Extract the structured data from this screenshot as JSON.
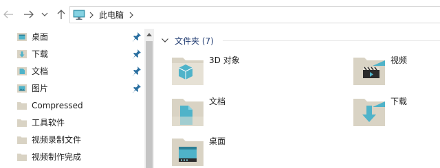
{
  "navigation": {
    "back_icon": "arrow-left-icon",
    "forward_icon": "arrow-right-icon",
    "recent_icon": "chevron-down-icon",
    "up_icon": "arrow-up-icon"
  },
  "address_bar": {
    "location_icon": "this-pc-icon",
    "path": "此电脑"
  },
  "sidebar": {
    "items": [
      {
        "label": "桌面",
        "icon": "desktop-folder-icon",
        "pinned": true
      },
      {
        "label": "下载",
        "icon": "downloads-folder-icon",
        "pinned": true
      },
      {
        "label": "文档",
        "icon": "documents-folder-icon",
        "pinned": true
      },
      {
        "label": "图片",
        "icon": "pictures-folder-icon",
        "pinned": true
      },
      {
        "label": "Compressed",
        "icon": "folder-icon",
        "pinned": false
      },
      {
        "label": "工具软件",
        "icon": "folder-icon",
        "pinned": false
      },
      {
        "label": "视频录制文件",
        "icon": "folder-icon",
        "pinned": false
      },
      {
        "label": "视频制作完成",
        "icon": "folder-icon",
        "pinned": false
      }
    ]
  },
  "content": {
    "group_title": "文件夹 (7)",
    "folders": [
      {
        "label": "3D 对象",
        "icon": "3d-objects-folder-icon"
      },
      {
        "label": "视频",
        "icon": "videos-folder-icon"
      },
      {
        "label": "文档",
        "icon": "documents-folder-icon"
      },
      {
        "label": "下载",
        "icon": "downloads-folder-icon"
      },
      {
        "label": "桌面",
        "icon": "desktop-folder-icon"
      }
    ]
  },
  "colors": {
    "folder_body": "#d9d3c4",
    "folder_accent": "#4fb3c9",
    "group_title": "#1f3a70"
  }
}
